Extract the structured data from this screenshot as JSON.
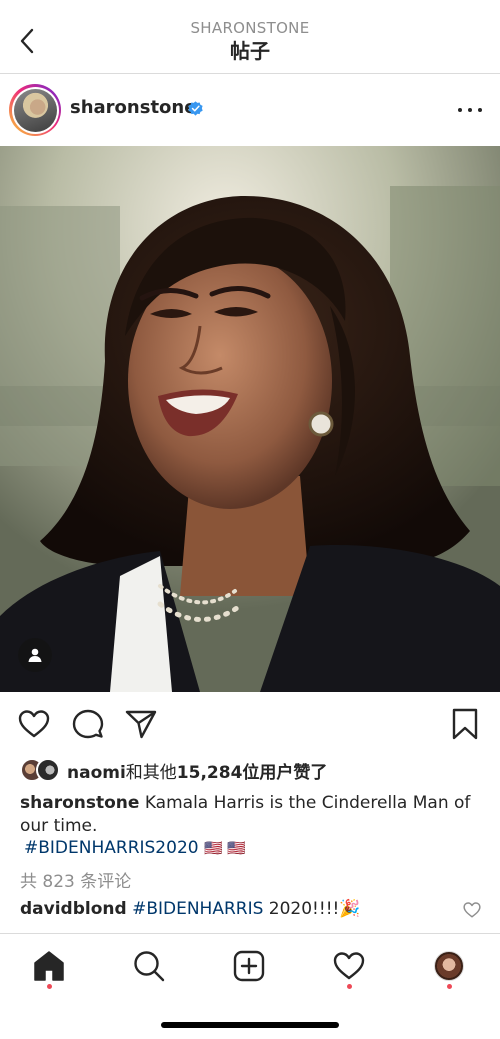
{
  "nav": {
    "overline": "SHARONSTONE",
    "title": "帖子"
  },
  "post": {
    "username": "sharonstone",
    "verified": true,
    "image_alt": "Portrait photo of a smiling woman with shoulder-length dark hair, pearl earrings and necklace, dark blazer"
  },
  "likes": {
    "username": "naomi",
    "middle": "和其他",
    "count": "15,284",
    "suffix": "位用户赞了"
  },
  "caption": {
    "username": "sharonstone",
    "text": "Kamala Harris is the Cinderella Man of our time.",
    "hashtag": "#BIDENHARRIS2020",
    "flags": "🇺🇸 🇺🇸"
  },
  "comments": {
    "view_all": "共 823 条评论",
    "first": {
      "username": "davidblond",
      "hashtag": "#BIDENHARRIS",
      "text": "2020!!!!🎉"
    }
  },
  "colors": {
    "link": "#00376b",
    "secondary": "#8e8e8e",
    "notification_dot": "#ed4956",
    "verified": "#3897f0"
  },
  "icons": {
    "back": "chevron-left-icon",
    "more": "ellipsis-icon",
    "like": "heart-icon",
    "comment": "comment-bubble-icon",
    "share": "paper-plane-icon",
    "save": "bookmark-icon",
    "tag": "person-tag-icon",
    "home": "home-icon",
    "search": "search-icon",
    "create": "plus-square-icon",
    "activity": "heart-icon",
    "profile": "profile-avatar"
  }
}
